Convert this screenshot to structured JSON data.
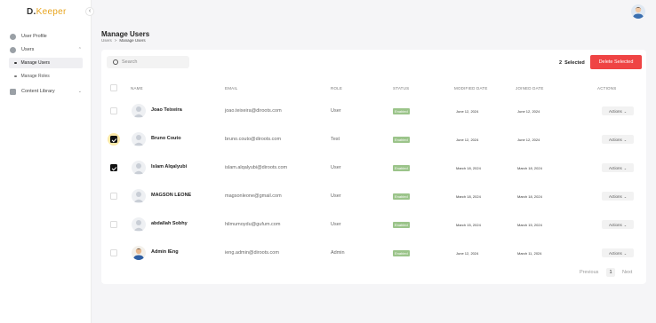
{
  "app": {
    "logo_initial": "D.",
    "logo_rest": "Keeper",
    "colors": {
      "brand": "#e8a51f",
      "danger": "#ef4444",
      "status_enabled": "#9bc48a"
    }
  },
  "sidebar": {
    "collapse_icon": "chevron-left-icon",
    "items": [
      {
        "label": "User Profile",
        "icon": "user-icon"
      },
      {
        "label": "Users",
        "icon": "users-icon"
      },
      {
        "label": "Content Library",
        "icon": "folder-icon"
      }
    ],
    "sub_items": [
      {
        "label": "Manage Users"
      },
      {
        "label": "Manage Roles"
      }
    ]
  },
  "header": {
    "title": "Manage Users",
    "breadcrumb": [
      "Users",
      ">",
      "Manage Users"
    ]
  },
  "toolbar": {
    "search_placeholder": "Search",
    "selected_count": "2",
    "selected_label": "Selected",
    "delete_label": "Delete Selected"
  },
  "table": {
    "headers": [
      "NAME",
      "EMAIL",
      "ROLE",
      "STATUS",
      "MODIFIED DATE",
      "JOINED DATE",
      "ACTIONS"
    ],
    "rows": [
      {
        "name": "Joao Teixeira",
        "email": "joao.teixeira@diroots.com",
        "role": "User",
        "status": "Enabled",
        "modified": "June 12, 2024",
        "joined": "June 12, 2024",
        "action": "Actions",
        "checked": false,
        "avatar": "placeholder"
      },
      {
        "name": "Bruno Couto",
        "email": "bruno.couto@diroots.com",
        "role": "Test",
        "status": "Enabled",
        "modified": "June 12, 2024",
        "joined": "June 12, 2024",
        "action": "Actions",
        "checked": true,
        "avatar": "placeholder"
      },
      {
        "name": "Islam Alqalyubi",
        "email": "islam.alqalyubi@diroots.com",
        "role": "User",
        "status": "Enabled",
        "modified": "March 18, 2024",
        "joined": "March 18, 2024",
        "action": "Actions",
        "checked": true,
        "avatar": "placeholder"
      },
      {
        "name": "MAGSON LEONE",
        "email": "magsonleone@gmail.com",
        "role": "User",
        "status": "Enabled",
        "modified": "March 18, 2024",
        "joined": "March 18, 2024",
        "action": "Actions",
        "checked": false,
        "avatar": "placeholder"
      },
      {
        "name": "abdallah Sobhy",
        "email": "hilmumoydu@gufum.com",
        "role": "User",
        "status": "Enabled",
        "modified": "March 15, 2024",
        "joined": "March 15, 2024",
        "action": "Actions",
        "checked": false,
        "avatar": "placeholder"
      },
      {
        "name": "Admin lEng",
        "email": "ieng.admin@diroots.com",
        "role": "Admin",
        "status": "Enabled",
        "modified": "June 12, 2024",
        "joined": "March 11, 2024",
        "action": "Actions",
        "checked": false,
        "avatar": "photo"
      }
    ]
  },
  "pagination": {
    "previous": "Previous",
    "current_page": "1",
    "next": "Next"
  }
}
